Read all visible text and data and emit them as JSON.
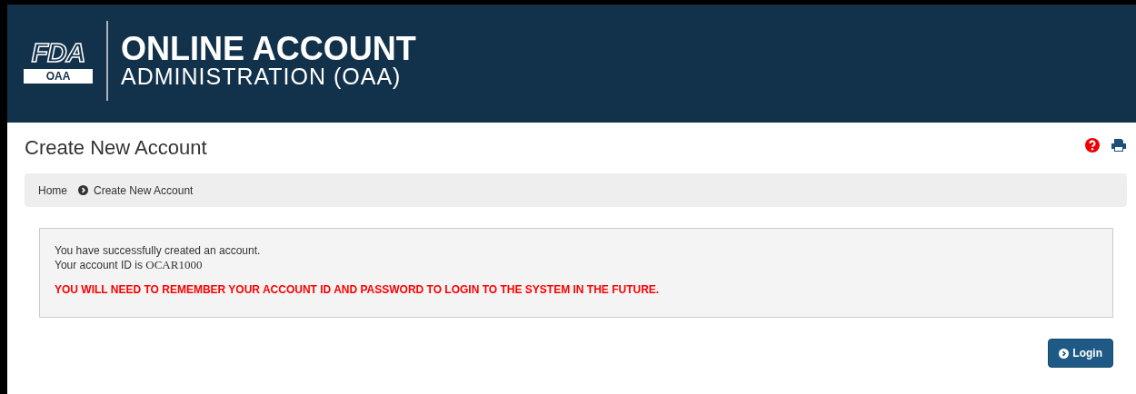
{
  "header": {
    "logo_top": "FDA",
    "logo_bottom": "OAA",
    "title": "ONLINE ACCOUNT",
    "subtitle": "ADMINISTRATION (OAA)"
  },
  "page_title": "Create New Account",
  "breadcrumb": [
    "Home",
    "Create New Account"
  ],
  "message": {
    "line_1": "You have successfully created an account.",
    "id_label": "Your account ID is",
    "account_id": "OCAR1000",
    "warning": "YOU WILL NEED TO REMEMBER YOUR ACCOUNT ID AND PASSWORD TO LOGIN TO THE SYSTEM IN THE FUTURE."
  },
  "buttons": [
    "Login"
  ]
}
